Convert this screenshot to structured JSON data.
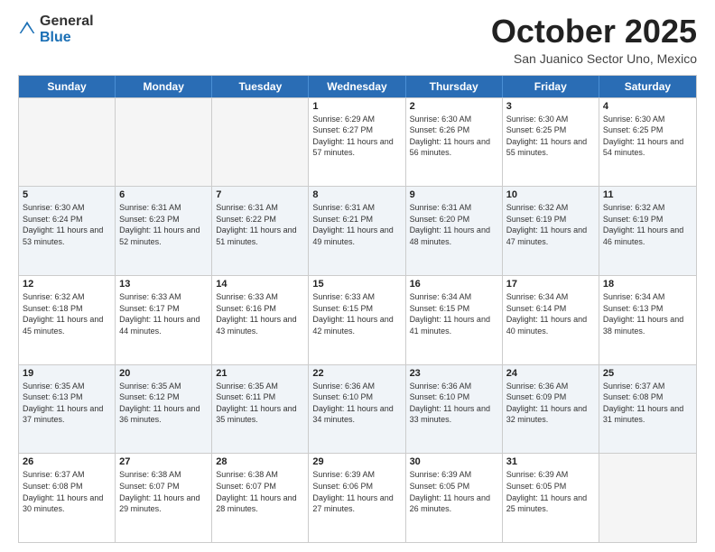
{
  "logo": {
    "general": "General",
    "blue": "Blue"
  },
  "header": {
    "month": "October 2025",
    "location": "San Juanico Sector Uno, Mexico"
  },
  "weekdays": [
    "Sunday",
    "Monday",
    "Tuesday",
    "Wednesday",
    "Thursday",
    "Friday",
    "Saturday"
  ],
  "weeks": [
    [
      {
        "day": "",
        "empty": true
      },
      {
        "day": "",
        "empty": true
      },
      {
        "day": "",
        "empty": true
      },
      {
        "day": "1",
        "rise": "6:29 AM",
        "set": "6:27 PM",
        "daylight": "11 hours and 57 minutes."
      },
      {
        "day": "2",
        "rise": "6:30 AM",
        "set": "6:26 PM",
        "daylight": "11 hours and 56 minutes."
      },
      {
        "day": "3",
        "rise": "6:30 AM",
        "set": "6:25 PM",
        "daylight": "11 hours and 55 minutes."
      },
      {
        "day": "4",
        "rise": "6:30 AM",
        "set": "6:25 PM",
        "daylight": "11 hours and 54 minutes."
      }
    ],
    [
      {
        "day": "5",
        "rise": "6:30 AM",
        "set": "6:24 PM",
        "daylight": "11 hours and 53 minutes."
      },
      {
        "day": "6",
        "rise": "6:31 AM",
        "set": "6:23 PM",
        "daylight": "11 hours and 52 minutes."
      },
      {
        "day": "7",
        "rise": "6:31 AM",
        "set": "6:22 PM",
        "daylight": "11 hours and 51 minutes."
      },
      {
        "day": "8",
        "rise": "6:31 AM",
        "set": "6:21 PM",
        "daylight": "11 hours and 49 minutes."
      },
      {
        "day": "9",
        "rise": "6:31 AM",
        "set": "6:20 PM",
        "daylight": "11 hours and 48 minutes."
      },
      {
        "day": "10",
        "rise": "6:32 AM",
        "set": "6:19 PM",
        "daylight": "11 hours and 47 minutes."
      },
      {
        "day": "11",
        "rise": "6:32 AM",
        "set": "6:19 PM",
        "daylight": "11 hours and 46 minutes."
      }
    ],
    [
      {
        "day": "12",
        "rise": "6:32 AM",
        "set": "6:18 PM",
        "daylight": "11 hours and 45 minutes."
      },
      {
        "day": "13",
        "rise": "6:33 AM",
        "set": "6:17 PM",
        "daylight": "11 hours and 44 minutes."
      },
      {
        "day": "14",
        "rise": "6:33 AM",
        "set": "6:16 PM",
        "daylight": "11 hours and 43 minutes."
      },
      {
        "day": "15",
        "rise": "6:33 AM",
        "set": "6:15 PM",
        "daylight": "11 hours and 42 minutes."
      },
      {
        "day": "16",
        "rise": "6:34 AM",
        "set": "6:15 PM",
        "daylight": "11 hours and 41 minutes."
      },
      {
        "day": "17",
        "rise": "6:34 AM",
        "set": "6:14 PM",
        "daylight": "11 hours and 40 minutes."
      },
      {
        "day": "18",
        "rise": "6:34 AM",
        "set": "6:13 PM",
        "daylight": "11 hours and 38 minutes."
      }
    ],
    [
      {
        "day": "19",
        "rise": "6:35 AM",
        "set": "6:13 PM",
        "daylight": "11 hours and 37 minutes."
      },
      {
        "day": "20",
        "rise": "6:35 AM",
        "set": "6:12 PM",
        "daylight": "11 hours and 36 minutes."
      },
      {
        "day": "21",
        "rise": "6:35 AM",
        "set": "6:11 PM",
        "daylight": "11 hours and 35 minutes."
      },
      {
        "day": "22",
        "rise": "6:36 AM",
        "set": "6:10 PM",
        "daylight": "11 hours and 34 minutes."
      },
      {
        "day": "23",
        "rise": "6:36 AM",
        "set": "6:10 PM",
        "daylight": "11 hours and 33 minutes."
      },
      {
        "day": "24",
        "rise": "6:36 AM",
        "set": "6:09 PM",
        "daylight": "11 hours and 32 minutes."
      },
      {
        "day": "25",
        "rise": "6:37 AM",
        "set": "6:08 PM",
        "daylight": "11 hours and 31 minutes."
      }
    ],
    [
      {
        "day": "26",
        "rise": "6:37 AM",
        "set": "6:08 PM",
        "daylight": "11 hours and 30 minutes."
      },
      {
        "day": "27",
        "rise": "6:38 AM",
        "set": "6:07 PM",
        "daylight": "11 hours and 29 minutes."
      },
      {
        "day": "28",
        "rise": "6:38 AM",
        "set": "6:07 PM",
        "daylight": "11 hours and 28 minutes."
      },
      {
        "day": "29",
        "rise": "6:39 AM",
        "set": "6:06 PM",
        "daylight": "11 hours and 27 minutes."
      },
      {
        "day": "30",
        "rise": "6:39 AM",
        "set": "6:05 PM",
        "daylight": "11 hours and 26 minutes."
      },
      {
        "day": "31",
        "rise": "6:39 AM",
        "set": "6:05 PM",
        "daylight": "11 hours and 25 minutes."
      },
      {
        "day": "",
        "empty": true
      }
    ]
  ],
  "labels": {
    "sunrise": "Sunrise:",
    "sunset": "Sunset:",
    "daylight": "Daylight:"
  }
}
